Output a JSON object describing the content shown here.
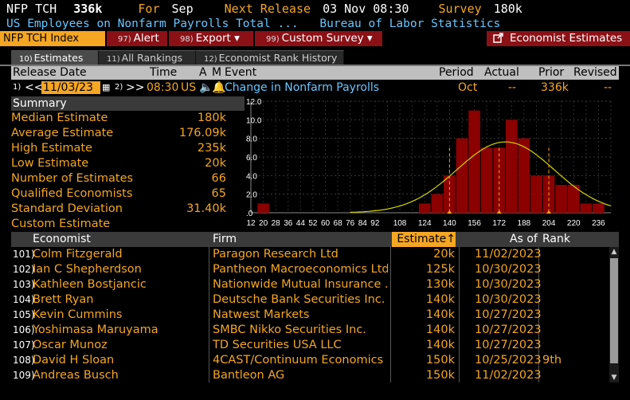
{
  "header": {
    "ticker": "NFP TCH",
    "value": "336k",
    "for_label": "For",
    "for_value": "Sep",
    "next_release_label": "Next Release",
    "next_release_value": "03 Nov 08:30",
    "survey_label": "Survey",
    "survey_value": "180k",
    "description": "US Employees on Nonfarm Payrolls Total ...",
    "source": "Bureau of Labor Statistics"
  },
  "toolbar": {
    "index_label": "NFP TCH Index",
    "alert_key": "97)",
    "alert_label": "Alert",
    "export_key": "98)",
    "export_label": "Export ▾",
    "survey_key": "99)",
    "survey_label": "Custom Survey ▾",
    "economist_label": "Economist Estimates"
  },
  "tabs": [
    {
      "key": "10)",
      "label": "Estimates"
    },
    {
      "key": "11)",
      "label": "All Rankings"
    },
    {
      "key": "12)",
      "label": "Economist Rank History"
    }
  ],
  "release": {
    "headers": {
      "date": "Release Date",
      "time": "Time",
      "a": "A",
      "m": "M",
      "event": "Event",
      "period": "Period",
      "actual": "Actual",
      "prior": "Prior",
      "revised": "Revised"
    },
    "prev_key": "1)",
    "date": "11/03/23",
    "next_key": "2)",
    "time": "08:30",
    "country": "US",
    "event": "Change in Nonfarm Payrolls",
    "period": "Oct",
    "actual": "--",
    "prior": "336k",
    "revised": "--"
  },
  "summary": {
    "title": "Summary",
    "rows": [
      {
        "label": "Median Estimate",
        "value": "180k"
      },
      {
        "label": "Average Estimate",
        "value": "176.09k"
      },
      {
        "label": "High Estimate",
        "value": "235k"
      },
      {
        "label": "Low Estimate",
        "value": "20k"
      },
      {
        "label": "Number of Estimates",
        "value": "66"
      },
      {
        "label": "Qualified Economists",
        "value": "65"
      },
      {
        "label": "Standard Deviation",
        "value": "31.40k"
      },
      {
        "label": "Custom Estimate",
        "value": ""
      }
    ]
  },
  "chart_data": {
    "type": "bar",
    "title": "",
    "xlabel": "",
    "ylabel": "",
    "ylim": [
      0,
      12
    ],
    "xlim": [
      12,
      244
    ],
    "ytick_labels": [
      "12.0",
      "10.0",
      "8.0",
      "6.0",
      "4.0",
      "2.0",
      ".0"
    ],
    "yticks": [
      12,
      10,
      8,
      6,
      4,
      2,
      0
    ],
    "xticks": [
      12,
      20,
      28,
      36,
      44,
      52,
      60,
      68,
      76,
      84,
      92,
      108,
      124,
      140,
      156,
      172,
      188,
      204,
      220,
      236
    ],
    "bin_width": 8,
    "bins": [
      {
        "x": 20,
        "count": 1
      },
      {
        "x": 124,
        "count": 1
      },
      {
        "x": 132,
        "count": 2
      },
      {
        "x": 140,
        "count": 4
      },
      {
        "x": 148,
        "count": 8
      },
      {
        "x": 156,
        "count": 11
      },
      {
        "x": 164,
        "count": 7
      },
      {
        "x": 172,
        "count": 7
      },
      {
        "x": 180,
        "count": 10
      },
      {
        "x": 188,
        "count": 8
      },
      {
        "x": 196,
        "count": 4
      },
      {
        "x": 204,
        "count": 4
      },
      {
        "x": 212,
        "count": 3
      },
      {
        "x": 220,
        "count": 3
      },
      {
        "x": 228,
        "count": 1
      },
      {
        "x": 236,
        "count": 1
      }
    ],
    "bar_color": "#8b0000",
    "curve_color": "#d4d400",
    "markers": [
      140,
      172,
      204
    ],
    "mean": 176.09,
    "std_dev": 31.4,
    "grid": true
  },
  "table": {
    "headers": {
      "economist": "Economist",
      "firm": "Firm",
      "estimate": "Estimate↑",
      "as_of": "As of",
      "rank": "Rank"
    },
    "rows": [
      {
        "num": "101)",
        "economist": "Colm Fitzgerald",
        "firm": "Paragon Research Ltd",
        "estimate": "20k",
        "as_of": "11/02/2023",
        "rank": ""
      },
      {
        "num": "102)",
        "economist": "Ian C Shepherdson",
        "firm": "Pantheon Macroeconomics Ltd",
        "estimate": "125k",
        "as_of": "10/30/2023",
        "rank": ""
      },
      {
        "num": "103)",
        "economist": "Kathleen Bostjancic",
        "firm": "Nationwide Mutual Insurance ...",
        "estimate": "130k",
        "as_of": "10/30/2023",
        "rank": ""
      },
      {
        "num": "104)",
        "economist": "Brett Ryan",
        "firm": "Deutsche Bank Securities Inc.",
        "estimate": "140k",
        "as_of": "10/30/2023",
        "rank": ""
      },
      {
        "num": "105)",
        "economist": "Kevin Cummins",
        "firm": "Natwest Markets",
        "estimate": "140k",
        "as_of": "10/27/2023",
        "rank": ""
      },
      {
        "num": "106)",
        "economist": "Yoshimasa Maruyama",
        "firm": "SMBC Nikko Securities Inc.",
        "estimate": "140k",
        "as_of": "10/27/2023",
        "rank": ""
      },
      {
        "num": "107)",
        "economist": "Oscar Munoz",
        "firm": "TD Securities USA LLC",
        "estimate": "140k",
        "as_of": "10/27/2023",
        "rank": ""
      },
      {
        "num": "108)",
        "economist": "David H Sloan",
        "firm": "4CAST/Continuum Economics",
        "estimate": "150k",
        "as_of": "10/25/2023",
        "rank": "9th"
      },
      {
        "num": "109)",
        "economist": "Andreas Busch",
        "firm": "Bantleon AG",
        "estimate": "150k",
        "as_of": "11/02/2023",
        "rank": ""
      }
    ]
  }
}
